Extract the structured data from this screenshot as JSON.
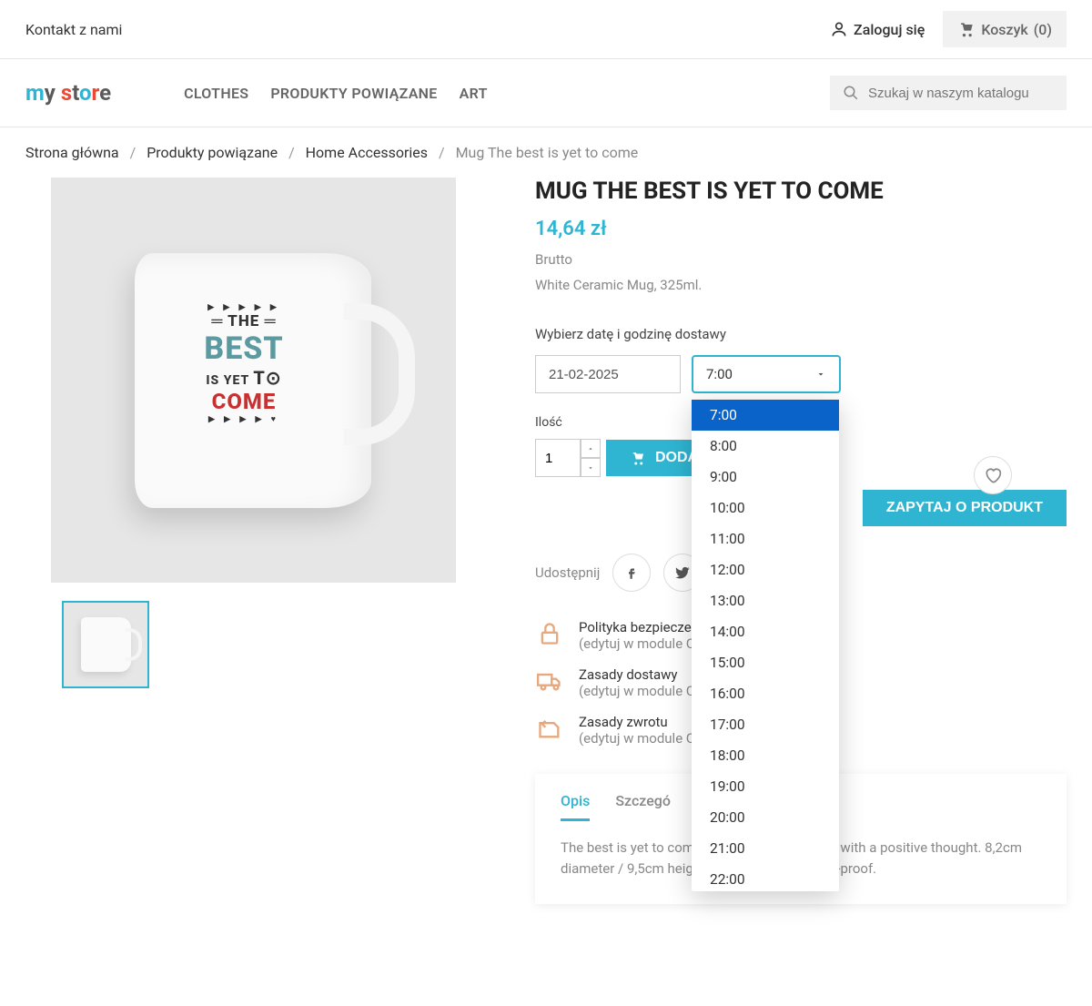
{
  "topbar": {
    "contact": "Kontakt z nami",
    "login": "Zaloguj się",
    "cart_label": "Koszyk",
    "cart_count": "(0)"
  },
  "logo": {
    "text": "my store"
  },
  "nav": {
    "items": [
      "CLOTHES",
      "PRODUKTY POWIĄZANE",
      "ART"
    ]
  },
  "search": {
    "placeholder": "Szukaj w naszym katalogu"
  },
  "breadcrumbs": {
    "items": [
      "Strona główna",
      "Produkty powiązane",
      "Home Accessories"
    ],
    "current": "Mug The best is yet to come"
  },
  "product": {
    "title": "MUG THE BEST IS YET TO COME",
    "price": "14,64 zł",
    "tax": "Brutto",
    "desc": "White Ceramic Mug, 325ml.",
    "delivery_label": "Wybierz datę i godzinę dostawy",
    "date_value": "21-02-2025",
    "time_value": "7:00",
    "time_options": [
      "7:00",
      "8:00",
      "9:00",
      "10:00",
      "11:00",
      "12:00",
      "13:00",
      "14:00",
      "15:00",
      "16:00",
      "17:00",
      "18:00",
      "19:00",
      "20:00",
      "21:00",
      "22:00"
    ],
    "qty_label": "Ilość",
    "qty_value": "1",
    "add_cart": "DODA",
    "ask": "ZAPYTAJ O PRODUKT",
    "share": "Udostępnij"
  },
  "reassurance": {
    "items": [
      {
        "title": "Polityka bezpiecze",
        "sub": "(edytuj w module C"
      },
      {
        "title": "Zasady dostawy",
        "sub": "(edytuj w module C"
      },
      {
        "title": "Zasady zwrotu",
        "sub": "(edytuj w module C"
      }
    ]
  },
  "tabs": {
    "items": [
      "Opis",
      "Szczegó"
    ],
    "content": "The best is yet to come! Start the day off right with a positive thought. 8,2cm diameter / 9,5cm height / 0.43kg. Dishwasher-proof."
  }
}
